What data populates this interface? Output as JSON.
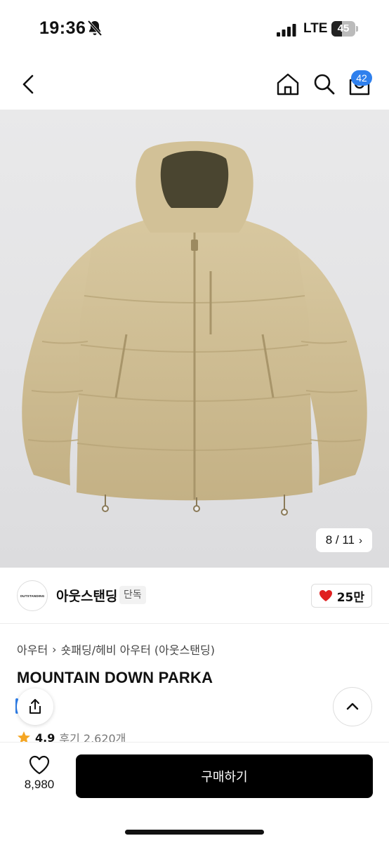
{
  "status_bar": {
    "time": "19:36",
    "network": "LTE",
    "battery": "45",
    "battery_level": 0.45,
    "icons": [
      "bell-slash-icon",
      "signal-icon",
      "battery-icon"
    ]
  },
  "nav": {
    "cart_badge": "42",
    "icons": [
      "back-icon",
      "home-icon",
      "search-icon",
      "cart-icon"
    ]
  },
  "gallery": {
    "counter": "8 / 11",
    "chevron": "›",
    "background": "#e6e6e8",
    "product_color": "#cfbd93"
  },
  "brand": {
    "logo_text": "OUTSTANDING",
    "name": "아웃스탠딩",
    "tag": "단독",
    "likes": "25만",
    "like_color": "#e02020"
  },
  "product": {
    "breadcrumb_root": "아우터",
    "breadcrumb_sep": "›",
    "breadcrumb_sub": "숏패딩/헤비 아우터 (아웃스탠딩)",
    "title": "MOUNTAIN DOWN PARKA",
    "rating": "4.9",
    "reviews": "후기 2,620개",
    "star_color": "#f5a623"
  },
  "bottom_bar": {
    "wish_count": "8,980",
    "buy_label": "구매하기"
  }
}
